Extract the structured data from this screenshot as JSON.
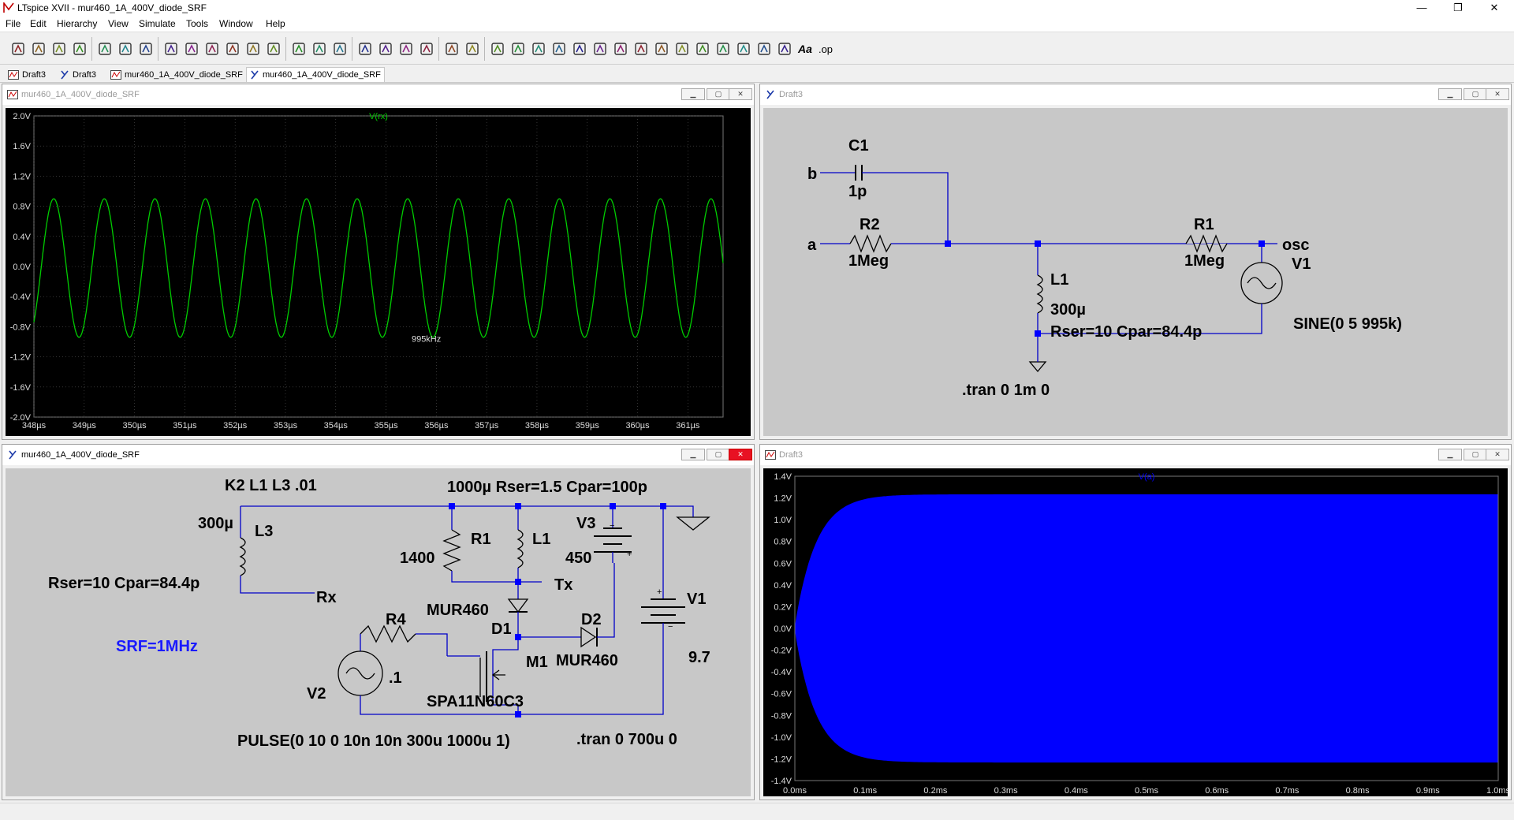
{
  "app": {
    "title": "LTspice XVII - mur460_1A_400V_diode_SRF"
  },
  "window_controls": {
    "minimize": "—",
    "restore": "❐",
    "close": "✕"
  },
  "menu": [
    "File",
    "Edit",
    "Hierarchy",
    "View",
    "Simulate",
    "Tools",
    "Window",
    "Help"
  ],
  "toolbar": {
    "buttons": [
      "run-icon",
      "open-icon",
      "save-icon",
      "control-panel-icon",
      "halt-icon",
      "pan-icon",
      "zoom-in-icon",
      "zoom-fit-icon",
      "zoom-out-icon",
      "zoom-cancel-icon",
      "autorange-icon",
      "mark-icon",
      "tile-horizontal-icon",
      "tile-vertical-icon",
      "cascade-icon",
      "cut-icon",
      "copy-icon",
      "paste-icon",
      "find-icon",
      "print-setup-icon",
      "print-icon",
      "wire-icon",
      "ground-icon",
      "label-icon",
      "resistor-icon",
      "capacitor-icon",
      "inductor-icon",
      "diode-icon",
      "component-icon",
      "move-icon",
      "drag-icon",
      "undo-icon",
      "redo-icon",
      "rotate-icon",
      "mirror-icon",
      "text-icon",
      "spice-directive-icon"
    ],
    "text_label": "Aa",
    "op_label": ".op"
  },
  "tabs": [
    {
      "label": "Draft3",
      "kind": "waveform"
    },
    {
      "label": "Draft3",
      "kind": "schematic"
    },
    {
      "label": "mur460_1A_400V_diode_SRF",
      "kind": "waveform"
    },
    {
      "label": "mur460_1A_400V_diode_SRF",
      "kind": "schematic",
      "active": true
    }
  ],
  "windows": {
    "plot1": {
      "title": "mur460_1A_400V_diode_SRF",
      "trace_label": "V(rx)",
      "trace_color": "#00cc00",
      "annotation": "995kHz",
      "y_ticks": [
        "2.0V",
        "1.6V",
        "1.2V",
        "0.8V",
        "0.4V",
        "0.0V",
        "-0.4V",
        "-0.8V",
        "-1.2V",
        "-1.6V",
        "-2.0V"
      ],
      "x_ticks": [
        "348µs",
        "349µs",
        "350µs",
        "351µs",
        "352µs",
        "353µs",
        "354µs",
        "355µs",
        "356µs",
        "357µs",
        "358µs",
        "359µs",
        "360µs",
        "361µs"
      ]
    },
    "sch1": {
      "title": "Draft3",
      "labels": {
        "b": "b",
        "a": "a",
        "osc": "osc",
        "c1": "C1",
        "c1v": "1p",
        "r2": "R2",
        "r2v": "1Meg",
        "r1": "R1",
        "r1v": "1Meg",
        "l1": "L1",
        "l1v": "300µ",
        "l1p": "Rser=10 Cpar=84.4p",
        "v1": "V1",
        "v1v": "SINE(0 5 995k)",
        "tran": ".tran 0 1m 0"
      }
    },
    "sch2": {
      "title": "mur460_1A_400V_diode_SRF",
      "labels": {
        "k2": "K2 L1 L3 .01",
        "l1p": "1000µ Rser=1.5 Cpar=100p",
        "l3v": "300µ",
        "l3": "L3",
        "l3p": "Rser=10 Cpar=84.4p",
        "rx": "Rx",
        "r1": "R1",
        "r1v": "1400",
        "l1": "L1",
        "tx": "Tx",
        "v3": "V3",
        "v3v": "450",
        "d1v": "MUR460",
        "d1": "D1",
        "d2": "D2",
        "d2v": "MUR460",
        "v1": "V1",
        "v1v": "9.7",
        "srf": "SRF=1MHz",
        "r4": "R4",
        "r4v": ".1",
        "m1": "M1",
        "m1v": "SPA11N60C3",
        "v2": "V2",
        "pulse": "PULSE(0 10 0 10n 10n 300u 1000u 1)",
        "tran": ".tran 0 700u 0"
      },
      "srf_color": "#1a1aff"
    },
    "plot2": {
      "title": "Draft3",
      "trace_label": "V(a)",
      "trace_color": "#0000ff",
      "y_ticks": [
        "1.4V",
        "1.2V",
        "1.0V",
        "0.8V",
        "0.6V",
        "0.4V",
        "0.2V",
        "0.0V",
        "-0.2V",
        "-0.4V",
        "-0.6V",
        "-0.8V",
        "-1.0V",
        "-1.2V",
        "-1.4V"
      ],
      "x_ticks": [
        "0.0ms",
        "0.1ms",
        "0.2ms",
        "0.3ms",
        "0.4ms",
        "0.5ms",
        "0.6ms",
        "0.7ms",
        "0.8ms",
        "0.9ms",
        "1.0ms"
      ]
    }
  },
  "chart_data": [
    {
      "type": "line",
      "title": "V(rx)",
      "xlabel": "",
      "ylabel": "",
      "xlim": [
        348,
        361.7
      ],
      "x_unit": "µs",
      "ylim": [
        -2.0,
        2.0
      ],
      "y_unit": "V",
      "series": [
        {
          "name": "V(rx)",
          "waveform": "sine",
          "amplitude": 0.92,
          "offset": -0.02,
          "frequency_per_us": 0.995,
          "first_peak_us": 349.4
        }
      ],
      "annotations": [
        "995kHz"
      ],
      "grid": true
    },
    {
      "type": "area",
      "title": "V(a)",
      "xlabel": "",
      "ylabel": "",
      "xlim": [
        0.0,
        1.0
      ],
      "x_unit": "ms",
      "ylim": [
        -1.4,
        1.4
      ],
      "y_unit": "V",
      "series": [
        {
          "name": "V(a)",
          "envelope": "exponential-rise",
          "final_amplitude": 1.23,
          "time_constant_ms": 0.03
        }
      ],
      "grid": false
    }
  ]
}
